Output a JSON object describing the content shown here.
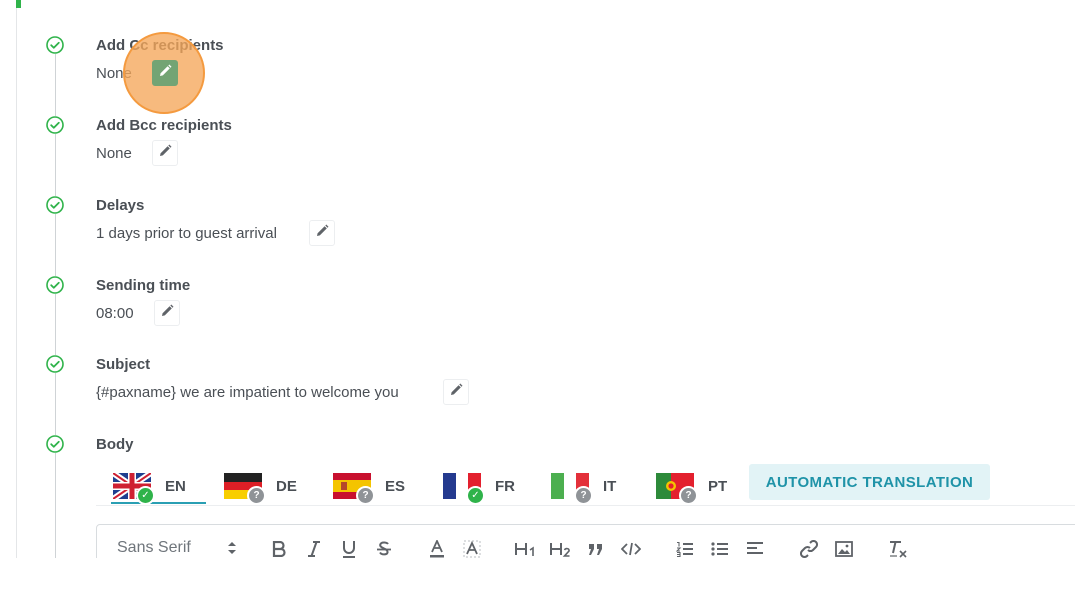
{
  "steps": [
    {
      "title": "Add Cc recipients",
      "value": "None",
      "edit_active": true
    },
    {
      "title": "Add Bcc recipients",
      "value": "None",
      "edit_active": false
    },
    {
      "title": "Delays",
      "value": "1 days prior to guest arrival",
      "edit_active": false
    },
    {
      "title": "Sending time",
      "value": "08:00",
      "edit_active": false
    },
    {
      "title": "Subject",
      "value": "{#paxname} we are impatient to welcome you",
      "edit_active": false
    },
    {
      "title": "Body"
    }
  ],
  "languages": [
    {
      "code": "EN",
      "status": "translated",
      "selected": true
    },
    {
      "code": "DE",
      "status": "missing"
    },
    {
      "code": "ES",
      "status": "missing"
    },
    {
      "code": "FR",
      "status": "translated"
    },
    {
      "code": "IT",
      "status": "missing"
    },
    {
      "code": "PT",
      "status": "missing"
    }
  ],
  "auto_translation_label": "AUTOMATIC TRANSLATION",
  "editor": {
    "font": "Sans Serif",
    "tools": [
      "bold",
      "italic",
      "underline",
      "strike",
      "text-color",
      "highlight",
      "h1",
      "h2",
      "blockquote",
      "code",
      "ordered-list",
      "bullet-list",
      "align",
      "link",
      "image",
      "clear-format"
    ]
  },
  "colors": {
    "accent": "#2a9fb3",
    "success": "#2fb34a",
    "highlight": "#f5a65a"
  }
}
